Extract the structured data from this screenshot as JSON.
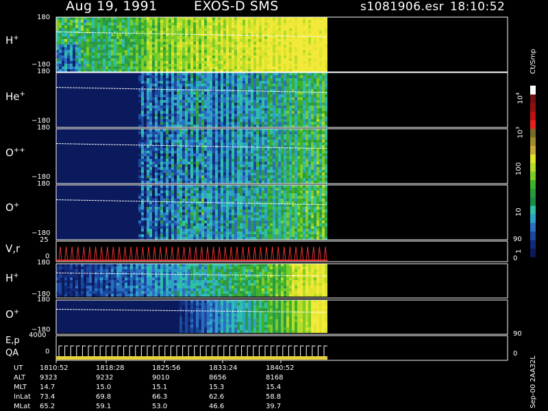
{
  "header": {
    "title_date": "Aug 19, 1991",
    "title_instrument": "EXOS-D SMS",
    "file_name": "s1081906.esr",
    "time": "18:10:52"
  },
  "colorbar": {
    "unit_label": "Ct/Smp",
    "tick_labels": [
      "10^4",
      "10^3",
      "100",
      "10",
      "1"
    ]
  },
  "panels": [
    {
      "id": "h-plus-top",
      "label": "H",
      "sup": "+",
      "y_top": "180",
      "y_bottom": "−180",
      "scheme": "h",
      "end": 1.0
    },
    {
      "id": "he-plus",
      "label": "He",
      "sup": "+",
      "y_top": "180",
      "y_bottom": "−180",
      "scheme": "he",
      "end": 1.0
    },
    {
      "id": "o-plus-plus",
      "label": "O",
      "sup": "++",
      "y_top": "180",
      "y_bottom": "−180",
      "scheme": "opp",
      "end": 1.0
    },
    {
      "id": "o-plus-top",
      "label": "O",
      "sup": "+",
      "y_top": "180",
      "y_bottom": "−180",
      "scheme": "op",
      "end": 1.0
    },
    {
      "id": "h-plus-lower",
      "label": "H",
      "sup": "+",
      "y_top": "180",
      "y_bottom": "−180",
      "scheme": "h2",
      "end": 1.0
    },
    {
      "id": "o-plus-lower",
      "label": "O",
      "sup": "+",
      "y_top": "180",
      "y_bottom": "−180",
      "scheme": "o2",
      "end": 1.0
    }
  ],
  "vr_panel": {
    "label": "V,r",
    "y_top": "25",
    "y_bottom": "0",
    "right_top": "90",
    "right_bottom": "0"
  },
  "ep_panel": {
    "label_line1": "E,p",
    "label_line2": "QA",
    "y_top": "4000",
    "y_bottom": "0",
    "right_top": "90",
    "right_bottom": "0"
  },
  "ephemeris": {
    "rows": [
      {
        "name": "UT",
        "values": [
          "1810:52",
          "1818:28",
          "1825:56",
          "1833:24",
          "1840:52"
        ]
      },
      {
        "name": "ALT",
        "values": [
          "9323",
          "9232",
          "9010",
          "8656",
          "8168"
        ]
      },
      {
        "name": "MLT",
        "values": [
          "14.7",
          "15.0",
          "15.1",
          "15.3",
          "15.4"
        ]
      },
      {
        "name": "InLat",
        "values": [
          "73.4",
          "69.8",
          "66.3",
          "62.6",
          "58.8"
        ]
      },
      {
        "name": "MLat",
        "values": [
          "65.2",
          "59.1",
          "53.0",
          "46.6",
          "39.7"
        ]
      }
    ]
  },
  "side_note": "Sep-00 2AA32L",
  "chart_data": {
    "type": "heatmap",
    "title": "Aug 19, 1991   EXOS-D SMS",
    "x": [
      "1810:52",
      "1818:28",
      "1825:56",
      "1833:24",
      "1840:52"
    ],
    "series": [
      {
        "name": "H+"
      },
      {
        "name": "He+"
      },
      {
        "name": "O++"
      },
      {
        "name": "O+"
      },
      {
        "name": "H+"
      },
      {
        "name": "O+"
      }
    ],
    "ylim": [
      -180,
      180
    ],
    "colorbar_scale": "log",
    "colorbar_range": [
      1,
      10000
    ]
  }
}
